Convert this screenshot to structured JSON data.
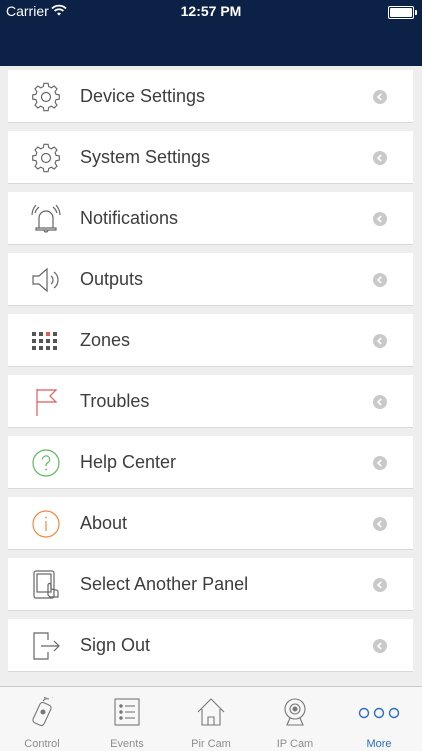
{
  "status_bar": {
    "carrier": "Carrier",
    "time": "12:57 PM"
  },
  "menu": {
    "items": [
      {
        "label": "Device Settings",
        "icon": "gear-icon"
      },
      {
        "label": "System Settings",
        "icon": "gear-icon"
      },
      {
        "label": "Notifications",
        "icon": "alarm-bell-icon"
      },
      {
        "label": "Outputs",
        "icon": "speaker-icon"
      },
      {
        "label": "Zones",
        "icon": "zones-grid-icon"
      },
      {
        "label": "Troubles",
        "icon": "flag-icon"
      },
      {
        "label": "Help Center",
        "icon": "question-circle-icon"
      },
      {
        "label": "About",
        "icon": "info-circle-icon"
      },
      {
        "label": "Select Another Panel",
        "icon": "tablet-touch-icon"
      },
      {
        "label": "Sign Out",
        "icon": "sign-out-icon"
      }
    ]
  },
  "tab_bar": {
    "tabs": [
      {
        "label": "Control",
        "icon": "remote-icon"
      },
      {
        "label": "Events",
        "icon": "events-list-icon"
      },
      {
        "label": "Pir Cam",
        "icon": "house-icon"
      },
      {
        "label": "IP Cam",
        "icon": "webcam-icon"
      },
      {
        "label": "More",
        "icon": "more-dots-icon",
        "active": true
      }
    ]
  },
  "colors": {
    "header": "#0c2146",
    "accent": "#2b6cc4",
    "troubles": "#e05a5a",
    "help": "#5cb85c",
    "about": "#f0883e"
  }
}
